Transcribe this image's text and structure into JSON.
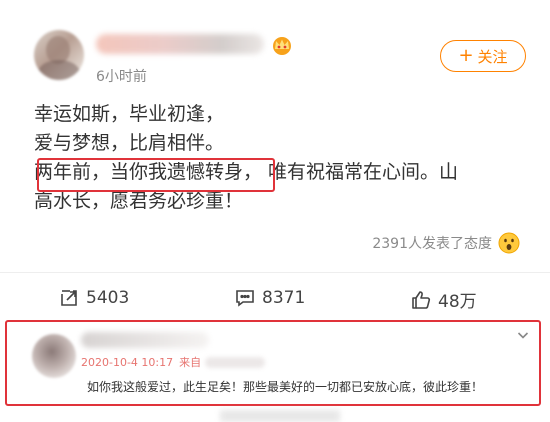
{
  "post": {
    "time": "6小时前",
    "follow_label": "关注",
    "lines": [
      "幸运如斯，毕业初逢，",
      "爱与梦想，比肩相伴。",
      "两年前，当你我遗憾转身，",
      "唯有祝福常在心间。山",
      "高水长，愿君务必珍重！"
    ],
    "reactions_text": "2391人发表了态度"
  },
  "actions": {
    "repost_count": "5403",
    "comment_count": "8371",
    "like_count": "48万"
  },
  "comment": {
    "timestamp": "2020-10-4 10:17",
    "source_prefix": "来自",
    "text": "如你我这般爱过，此生足矣！那些最美好的一切都已安放心底，彼此珍重！"
  },
  "colors": {
    "accent": "#ff8200",
    "highlight_border": "#e0333a",
    "meta_red": "#e77470"
  }
}
